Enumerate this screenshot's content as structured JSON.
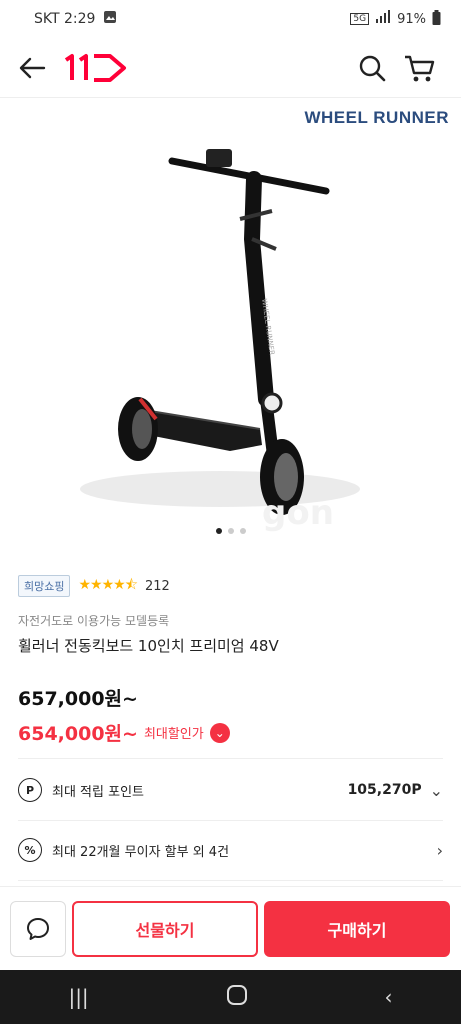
{
  "status_bar": {
    "carrier_time": "SKT 2:29",
    "network": "5G",
    "battery": "91%"
  },
  "header": {
    "back_icon": "back-arrow-icon",
    "logo_text": "11",
    "search_icon": "search-icon",
    "cart_icon": "cart-icon"
  },
  "product": {
    "brand": "WHEEL RUNNER",
    "badge": "희망쇼핑",
    "rating_stars": 4.5,
    "review_count": "212",
    "subtitle": "자전거도로 이용가능 모델등록",
    "title": "휠러너 전동킥보드 10인치 프리미엄 48V",
    "price": "657,000원~",
    "sale_price": "654,000원~",
    "sale_label": "최대할인가"
  },
  "benefits": [
    {
      "icon": "P",
      "label": "최대 적립 포인트",
      "value": "105,270P"
    },
    {
      "icon": "%",
      "label": "최대 22개월 무이자 할부 외 4건",
      "value": ""
    }
  ],
  "bottom": {
    "chat_icon": "chat-icon",
    "gift_label": "선물하기",
    "buy_label": "구매하기"
  },
  "colors": {
    "accent": "#f43142",
    "brand_blue": "#2b4c7e"
  }
}
